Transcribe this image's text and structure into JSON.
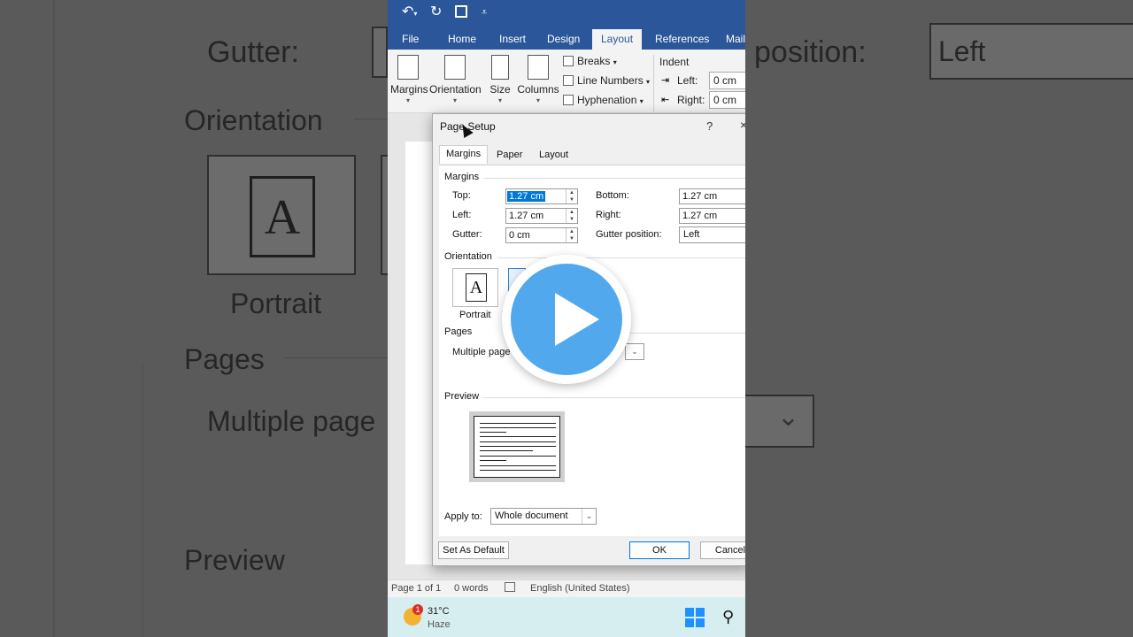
{
  "quick_access": {
    "undo_icon": "undo-icon",
    "redo_icon": "redo-icon",
    "save_icon": "save-icon",
    "customize_icon": "customize-caret-icon"
  },
  "ribbon_tabs": [
    "File",
    "Home",
    "Insert",
    "Design",
    "Layout",
    "References",
    "Mail"
  ],
  "active_tab": "Layout",
  "ribbon": {
    "margins": "Margins",
    "orientation": "Orientation",
    "size": "Size",
    "columns": "Columns",
    "breaks": "Breaks",
    "line_numbers": "Line Numbers",
    "hyphenation": "Hyphenation",
    "indent_title": "Indent",
    "indent_left_label": "Left:",
    "indent_left_value": "0 cm",
    "indent_right_label": "Right:",
    "indent_right_value": "0 cm"
  },
  "dialog": {
    "title": "Page Setup",
    "help": "?",
    "close": "×",
    "tabs": [
      "Margins",
      "Paper",
      "Layout"
    ],
    "selected_tab": "Margins",
    "margins_group": "Margins",
    "top_label": "Top:",
    "top_value": "1.27 cm",
    "bottom_label": "Bottom:",
    "bottom_value": "1.27 cm",
    "left_label": "Left:",
    "left_value": "1.27 cm",
    "right_label": "Right:",
    "right_value": "1.27 cm",
    "gutter_label": "Gutter:",
    "gutter_value": "0 cm",
    "gutter_position_label": "Gutter position:",
    "gutter_position_value": "Left",
    "orientation_group": "Orientation",
    "portrait_label": "Portrait",
    "pages_group": "Pages",
    "multiple_pages_label": "Multiple page",
    "preview_group": "Preview",
    "apply_to_label": "Apply to:",
    "apply_to_value": "Whole document",
    "set_default_button": "Set As Default",
    "ok_button": "OK",
    "cancel_button": "Cancel"
  },
  "status_bar": {
    "page": "Page 1 of 1",
    "words": "0 words",
    "language": "English (United States)"
  },
  "taskbar": {
    "weather_badge": "1",
    "temperature": "31°C",
    "condition": "Haze"
  },
  "background": {
    "gutter": "Gutter:",
    "position": "position:",
    "left_value": "Left",
    "orientation": "Orientation",
    "portrait": "Portrait",
    "pages": "Pages",
    "multiple_pages": "Multiple page",
    "preview": "Preview"
  },
  "colors": {
    "word_blue": "#2b579a",
    "play_blue": "#52a8ec",
    "ok_border": "#0078d7",
    "taskbar": "#d7eef0"
  }
}
